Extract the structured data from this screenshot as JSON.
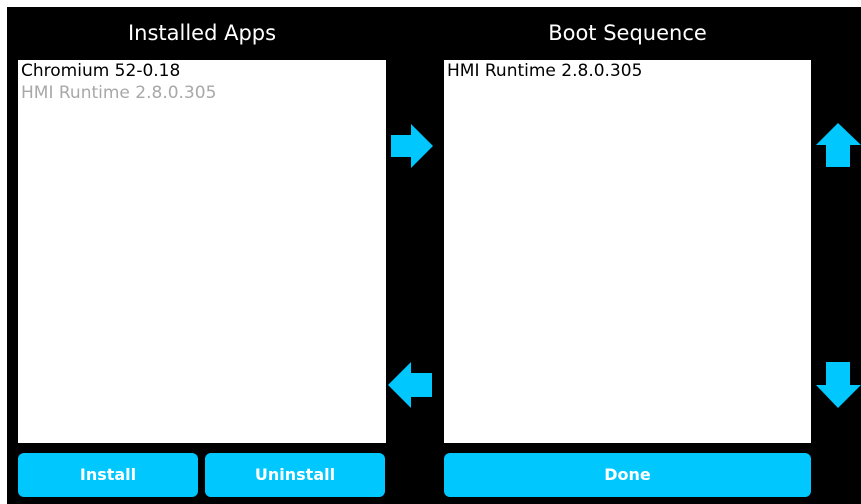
{
  "theme": {
    "background": "#000000",
    "accent": "#00C8FF",
    "list_background": "#FFFFFF",
    "disabled_text": "#A8A8A8"
  },
  "installed": {
    "title": "Installed Apps",
    "items": [
      {
        "label": "Chromium 52-0.18",
        "disabled": false
      },
      {
        "label": "HMI Runtime 2.8.0.305",
        "disabled": true
      }
    ],
    "install_label": "Install",
    "uninstall_label": "Uninstall"
  },
  "boot": {
    "title": "Boot Sequence",
    "items": [
      {
        "label": "HMI Runtime 2.8.0.305",
        "disabled": false
      }
    ],
    "done_label": "Done"
  },
  "icons": {
    "add_to_boot": "arrow-right-icon",
    "remove_from_boot": "arrow-left-icon",
    "move_up": "arrow-up-icon",
    "move_down": "arrow-down-icon"
  }
}
